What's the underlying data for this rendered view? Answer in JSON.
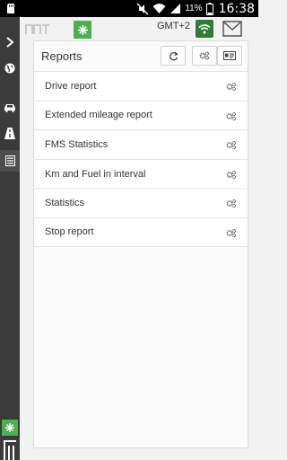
{
  "status_bar": {
    "battery_percent": "11%",
    "time": "16:38",
    "icons": [
      "sd-card-icon",
      "mute-icon",
      "wifi-icon",
      "signal-icon",
      "battery-icon"
    ]
  },
  "rail": {
    "items": [
      {
        "icon": "chevron-right-icon"
      },
      {
        "icon": "globe-icon"
      },
      {
        "icon": "car-icon"
      },
      {
        "icon": "road-icon"
      },
      {
        "icon": "report-list-icon"
      }
    ]
  },
  "header": {
    "timezone": "GMT+2"
  },
  "reports": {
    "title": "Reports",
    "items": [
      {
        "label": "Drive report"
      },
      {
        "label": "Extended mileage report"
      },
      {
        "label": "FMS Statistics"
      },
      {
        "label": "Km and Fuel in interval"
      },
      {
        "label": "Statistics"
      },
      {
        "label": "Stop report"
      }
    ]
  },
  "colors": {
    "accent_green": "#4caf50",
    "rail_bg": "#3b3b3b"
  }
}
